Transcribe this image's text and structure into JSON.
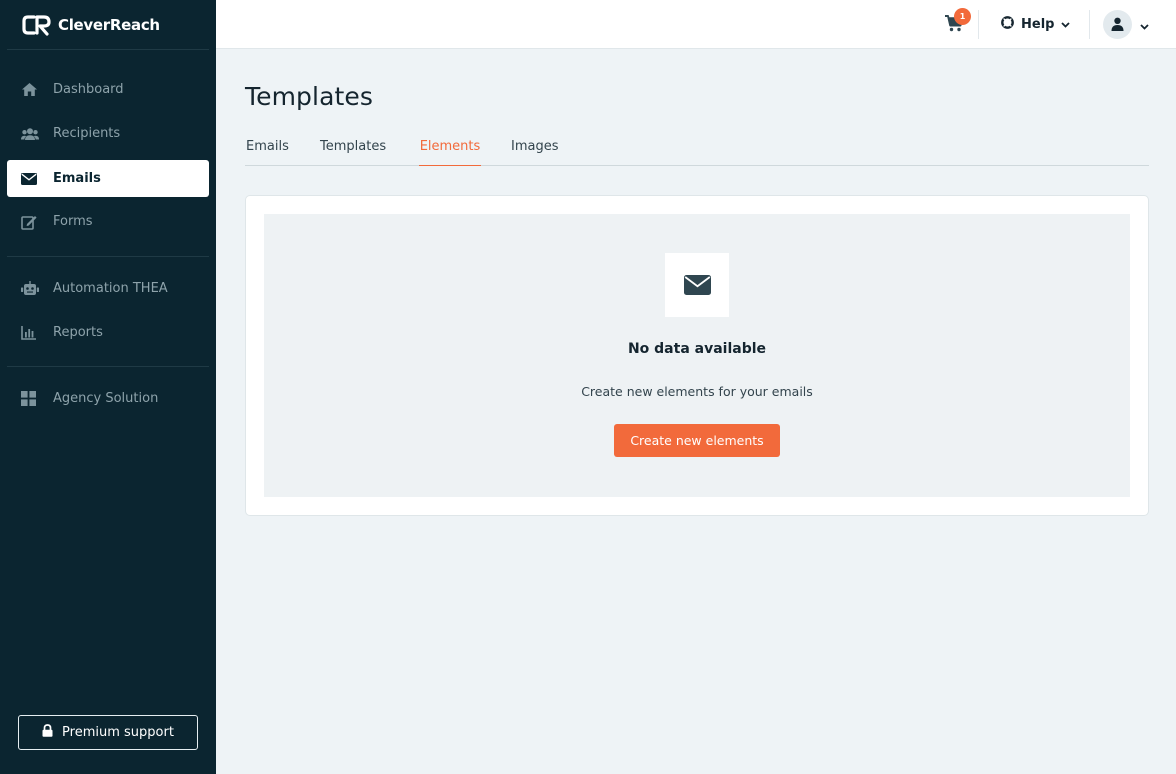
{
  "app": {
    "name": "CleverReach"
  },
  "sidebar": {
    "items": [
      {
        "label": "Dashboard",
        "icon": "home-icon"
      },
      {
        "label": "Recipients",
        "icon": "users-icon"
      },
      {
        "label": "Emails",
        "icon": "envelope-icon",
        "active": true
      },
      {
        "label": "Forms",
        "icon": "edit-icon"
      },
      {
        "label": "Automation THEA",
        "icon": "robot-icon"
      },
      {
        "label": "Reports",
        "icon": "chart-icon"
      },
      {
        "label": "Agency Solution",
        "icon": "grid-icon"
      }
    ],
    "premium_label": "Premium support"
  },
  "header": {
    "cart_count": "1",
    "help_label": "Help"
  },
  "main": {
    "title": "Templates",
    "tabs": [
      {
        "label": "Emails"
      },
      {
        "label": "Templates"
      },
      {
        "label": "Elements",
        "active": true
      },
      {
        "label": "Images"
      }
    ],
    "empty_state": {
      "title": "No data available",
      "subtitle": "Create new elements for your emails",
      "button_label": "Create new elements"
    }
  },
  "colors": {
    "sidebar_bg": "#0b2530",
    "accent": "#f26a3b",
    "page_bg": "#eef3f6"
  }
}
